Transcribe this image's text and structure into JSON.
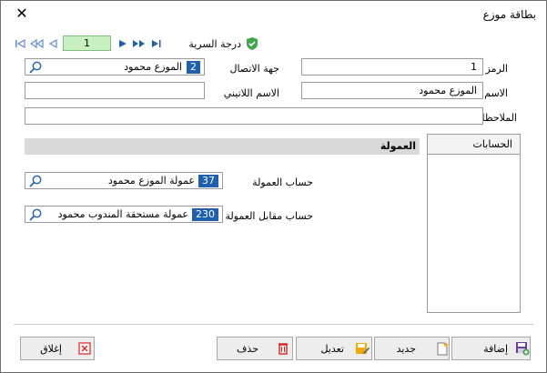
{
  "window": {
    "title": "بطاقة موزع"
  },
  "navigation": {
    "page": "1"
  },
  "security": {
    "label": "درجة السرية"
  },
  "form": {
    "code_label": "الرمز",
    "code_value": "1",
    "contact_label": "جهة الاتصال",
    "contact_code": "2",
    "contact_name": "الموزع محمود",
    "name_label": "الاسم",
    "name_value": "الموزع محمود",
    "latin_label": "الاسم اللاتيني",
    "latin_value": "",
    "notes_label": "الملاحظات",
    "notes_value": ""
  },
  "accounts_panel": {
    "header": "الحسابات"
  },
  "commission": {
    "section_title": "العمولة",
    "account_label": "حساب العمولة",
    "account_code": "37",
    "account_name": "عمولة الموزع محمود",
    "contra_label": "حساب مقابل العمولة",
    "contra_code": "230",
    "contra_name": "عمولة مستحقة المندوب محمود"
  },
  "buttons": {
    "add": "إضافة",
    "new": "جديد",
    "edit": "تعديل",
    "delete": "حذف",
    "close": "إغلاق"
  },
  "colors": {
    "accent": "#1f5fb0",
    "page_box": "#c8f0c0",
    "section_bar": "#d9d9d9"
  }
}
